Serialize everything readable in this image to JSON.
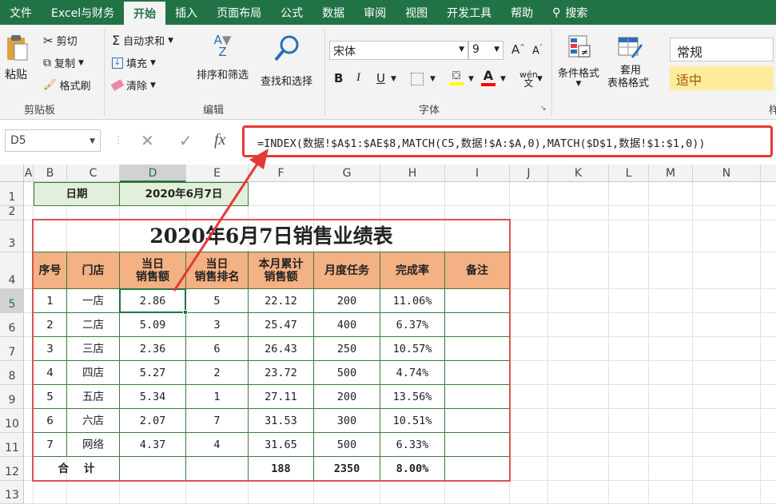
{
  "tabs": [
    "文件",
    "Excel与财务",
    "开始",
    "插入",
    "页面布局",
    "公式",
    "数据",
    "审阅",
    "视图",
    "开发工具",
    "帮助",
    "搜索"
  ],
  "ribbon": {
    "clipboard": {
      "paste": "粘贴",
      "cut": "剪切",
      "copy": "复制",
      "format_painter": "格式刷",
      "group": "剪贴板"
    },
    "editing": {
      "autosum": "自动求和",
      "fill": "填充",
      "clear": "清除",
      "sort_filter": "排序和筛选",
      "find_select": "查找和选择",
      "group": "编辑"
    },
    "font": {
      "name": "宋体",
      "size": "9",
      "bold": "B",
      "italic": "I",
      "underline": "U",
      "phonetic": "wén",
      "group": "字体"
    },
    "styles": {
      "conditional": "条件格式",
      "table_format_1": "套用",
      "table_format_2": "表格格式",
      "style_normal": "常规",
      "style_neutral": "适中",
      "group_partial": "样"
    }
  },
  "formula_bar": {
    "name_box": "D5",
    "fx": "fx",
    "formula": "=INDEX(数据!$A$1:$AE$8,MATCH(C5,数据!$A:$A,0),MATCH($D$1,数据!$1:$1,0))"
  },
  "columns": [
    "A",
    "B",
    "C",
    "D",
    "E",
    "F",
    "G",
    "H",
    "I",
    "J",
    "K",
    "L",
    "M",
    "N"
  ],
  "rows": [
    "1",
    "2",
    "3",
    "4",
    "5",
    "6",
    "7",
    "8",
    "9",
    "10",
    "11",
    "12",
    "13"
  ],
  "sheet": {
    "date_label": "日期",
    "date_value": "2020年6月7日",
    "title": "2020年6月7日销售业绩表",
    "headers": [
      "序号",
      "门店",
      "当日\n销售额",
      "当日\n销售排名",
      "本月累计\n销售额",
      "月度任务",
      "完成率",
      "备注"
    ],
    "data": [
      [
        "1",
        "一店",
        "2.86",
        "5",
        "22.12",
        "200",
        "11.06%",
        ""
      ],
      [
        "2",
        "二店",
        "5.09",
        "3",
        "25.47",
        "400",
        "6.37%",
        ""
      ],
      [
        "3",
        "三店",
        "2.36",
        "6",
        "26.43",
        "250",
        "10.57%",
        ""
      ],
      [
        "4",
        "四店",
        "5.27",
        "2",
        "23.72",
        "500",
        "4.74%",
        ""
      ],
      [
        "5",
        "五店",
        "5.34",
        "1",
        "27.11",
        "200",
        "13.56%",
        ""
      ],
      [
        "6",
        "六店",
        "2.07",
        "7",
        "31.53",
        "300",
        "10.51%",
        ""
      ],
      [
        "7",
        "网络",
        "4.37",
        "4",
        "31.65",
        "500",
        "6.33%",
        ""
      ]
    ],
    "total": [
      "合    计",
      "",
      "",
      "",
      "188",
      "2350",
      "8.00%",
      ""
    ]
  }
}
